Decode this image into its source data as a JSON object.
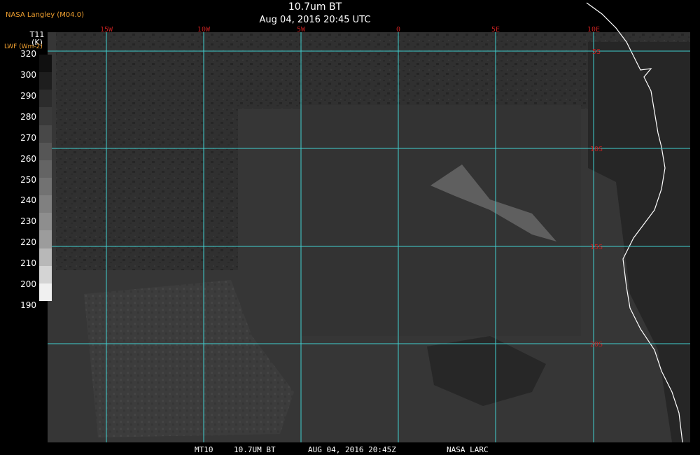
{
  "header": {
    "agency": "NASA Langley (M04.0)",
    "title": "10.7um BT",
    "datetime": "Aug 04, 2016 20:45 UTC"
  },
  "colorbar": {
    "title_line1": "T11",
    "title_line2": "(K)",
    "subtitle": "LWF (Wm-2)",
    "ticks": [
      "320",
      "300",
      "290",
      "280",
      "270",
      "260",
      "250",
      "240",
      "230",
      "220",
      "210",
      "200",
      "190"
    ],
    "levels": [
      "#101010",
      "#1e1e1e",
      "#2c2c2c",
      "#3a3a3a",
      "#484848",
      "#565656",
      "#646464",
      "#727272",
      "#808080",
      "#8e8e8e",
      "#9c9c9c",
      "#b8b8b8",
      "#d4d4d4",
      "#f0f0f0"
    ]
  },
  "map": {
    "longitude_labels": [
      "15W",
      "10W",
      "5W",
      "0",
      "5E",
      "10E"
    ],
    "latitude_labels": [
      "5S",
      "10S",
      "15S",
      "20S"
    ],
    "gridline_color": "#40d0d0",
    "lat_label_color": "#c02020",
    "lon_label_color": "#c02020"
  },
  "footer": {
    "product": "MT10",
    "channel": "10.7UM BT",
    "date": "AUG 04, 2016 20:45Z",
    "org": "NASA LARC"
  }
}
